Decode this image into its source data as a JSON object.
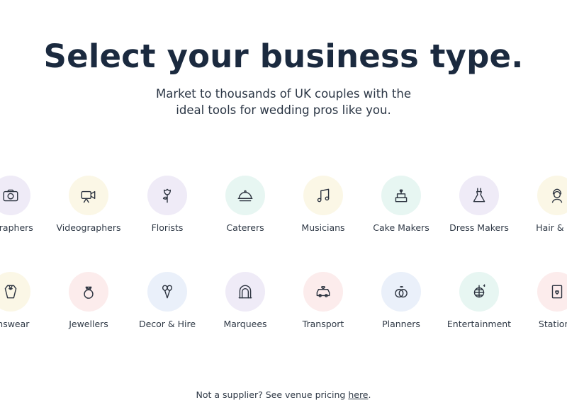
{
  "heading": "Select your business type.",
  "subheading_line1": "Market to thousands of UK couples with the",
  "subheading_line2": "ideal tools for wedding pros like you.",
  "row1": [
    {
      "label": "ographers",
      "icon": "camera-icon",
      "color": "#efebf7"
    },
    {
      "label": "Videographers",
      "icon": "video-camera-icon",
      "color": "#fbf7e6"
    },
    {
      "label": "Florists",
      "icon": "rose-icon",
      "color": "#efebf7"
    },
    {
      "label": "Caterers",
      "icon": "cloche-icon",
      "color": "#e7f6f2"
    },
    {
      "label": "Musicians",
      "icon": "music-notes-icon",
      "color": "#fbf7e6"
    },
    {
      "label": "Cake Makers",
      "icon": "wedding-cake-icon",
      "color": "#e7f6f2"
    },
    {
      "label": "Dress Makers",
      "icon": "wedding-dress-icon",
      "color": "#efebf7"
    },
    {
      "label": "Hair & Be",
      "icon": "bride-hair-icon",
      "color": "#fbf7e6"
    }
  ],
  "row2": [
    {
      "label": "enswear",
      "icon": "suit-icon",
      "color": "#fbf7e6"
    },
    {
      "label": "Jewellers",
      "icon": "ring-icon",
      "color": "#fcecec"
    },
    {
      "label": "Decor & Hire",
      "icon": "balloons-icon",
      "color": "#eaf0fa"
    },
    {
      "label": "Marquees",
      "icon": "arch-icon",
      "color": "#efebf7"
    },
    {
      "label": "Transport",
      "icon": "wedding-car-icon",
      "color": "#fcecec"
    },
    {
      "label": "Planners",
      "icon": "linked-rings-icon",
      "color": "#eaf0fa"
    },
    {
      "label": "Entertainment",
      "icon": "disco-ball-icon",
      "color": "#e7f6f2"
    },
    {
      "label": "Statione",
      "icon": "invitation-card-icon",
      "color": "#fcecec"
    }
  ],
  "footer": {
    "text": "Not a supplier? See venue pricing ",
    "link": "here",
    "suffix": "."
  }
}
